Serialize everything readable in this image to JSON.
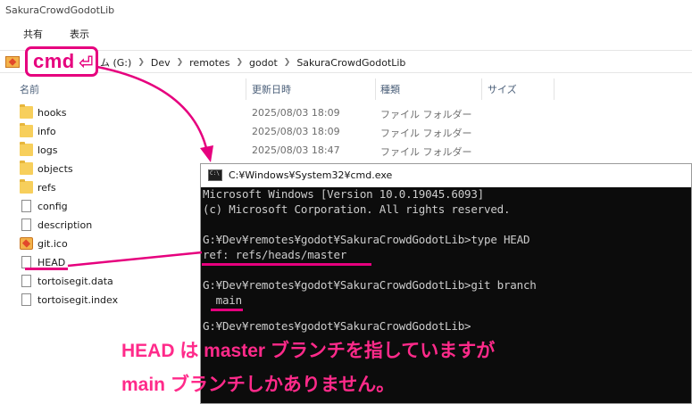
{
  "explorer": {
    "title": "SakuraCrowdGodotLib",
    "ribbon_tabs": [
      "共有",
      "表示"
    ],
    "breadcrumb": [
      "ム (G:)",
      "Dev",
      "remotes",
      "godot",
      "SakuraCrowdGodotLib"
    ],
    "columns": {
      "name": "名前",
      "date": "更新日時",
      "type": "種類",
      "size": "サイズ"
    },
    "files": [
      {
        "name": "hooks",
        "icon": "folder-icon",
        "date": "2025/08/03 18:09",
        "type": "ファイル フォルダー"
      },
      {
        "name": "info",
        "icon": "folder-icon",
        "date": "2025/08/03 18:09",
        "type": "ファイル フォルダー"
      },
      {
        "name": "logs",
        "icon": "folder-icon",
        "date": "2025/08/03 18:47",
        "type": "ファイル フォルダー"
      },
      {
        "name": "objects",
        "icon": "folder-icon",
        "date": "",
        "type": ""
      },
      {
        "name": "refs",
        "icon": "folder-icon",
        "date": "",
        "type": ""
      },
      {
        "name": "config",
        "icon": "file-icon",
        "date": "",
        "type": ""
      },
      {
        "name": "description",
        "icon": "file-icon",
        "date": "",
        "type": ""
      },
      {
        "name": "git.ico",
        "icon": "ico-file-icon",
        "date": "",
        "type": ""
      },
      {
        "name": "HEAD",
        "icon": "file-icon",
        "date": "",
        "type": ""
      },
      {
        "name": "tortoisegit.data",
        "icon": "file-icon",
        "date": "",
        "type": ""
      },
      {
        "name": "tortoisegit.index",
        "icon": "file-icon",
        "date": "",
        "type": ""
      }
    ]
  },
  "annotation": {
    "cmd_label": "cmd",
    "enter_symbol": "⏎",
    "accent_color": "#e6007e",
    "caption_line1": "HEAD は master ブランチを指していますが",
    "caption_line2": "main ブランチしかありません。"
  },
  "cmd": {
    "title": "C:¥Windows¥System32¥cmd.exe",
    "lines": [
      "Microsoft Windows [Version 10.0.19045.6093]",
      "(c) Microsoft Corporation. All rights reserved.",
      "",
      "G:¥Dev¥remotes¥godot¥SakuraCrowdGodotLib>type HEAD",
      "ref: refs/heads/master",
      "",
      "G:¥Dev¥remotes¥godot¥SakuraCrowdGodotLib>git branch",
      "  main",
      "",
      "G:¥Dev¥remotes¥godot¥SakuraCrowdGodotLib>"
    ]
  }
}
